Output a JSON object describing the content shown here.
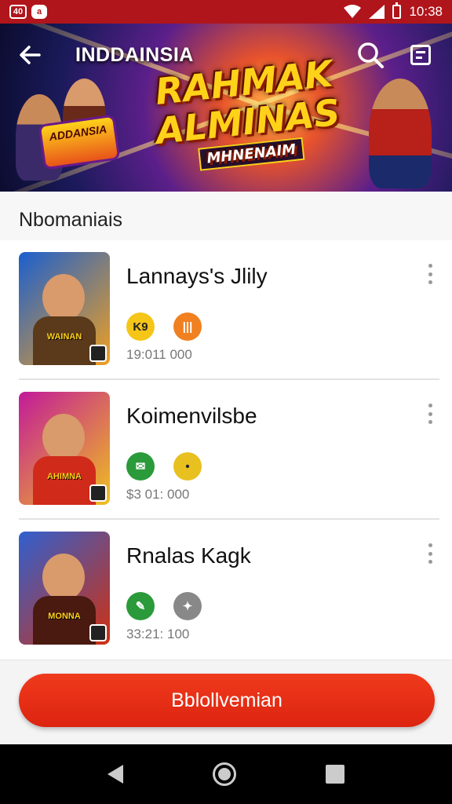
{
  "status_bar": {
    "time": "10:38",
    "left_icons": [
      "calendar-icon",
      "app-notification-icon"
    ],
    "left_icon_labels": [
      "40",
      "a"
    ]
  },
  "header": {
    "title": "INDDAINSIA",
    "hero_line1": "RAHMAK",
    "hero_line2": "ALMINAS",
    "hero_line3": "MHNENAIM",
    "hero_badge": "ADDANSIA"
  },
  "section": {
    "title": "Nbomaniais"
  },
  "items": [
    {
      "name": "Lannays's Jlily",
      "meta": "19:011 000",
      "thumb_label": "WAINAN",
      "thumb_colors": [
        "#1a5fd0",
        "#f0a020"
      ],
      "badges": [
        {
          "icon": "k9-badge-icon",
          "text": "K9",
          "bg": "#f5c518",
          "fg": "#222"
        },
        {
          "icon": "piano-badge-icon",
          "text": "|||",
          "bg": "#f08020",
          "fg": "#fff"
        }
      ]
    },
    {
      "name": "Koimenvilsbe",
      "meta": "$3 01: 000",
      "thumb_label": "AHIMNA",
      "thumb_colors": [
        "#c21a9a",
        "#f0c020"
      ],
      "badges": [
        {
          "icon": "chat-badge-icon",
          "text": "✉",
          "bg": "#2a9a3a",
          "fg": "#fff"
        },
        {
          "icon": "speech-badge-icon",
          "text": "•",
          "bg": "#e8c020",
          "fg": "#222"
        }
      ]
    },
    {
      "name": "Rnalas Kagk",
      "meta": "33:21: 100",
      "thumb_label": "MONNA",
      "thumb_colors": [
        "#d03010",
        "#3060d0"
      ],
      "badges": [
        {
          "icon": "leaf-badge-icon",
          "text": "✎",
          "bg": "#2a9a3a",
          "fg": "#fff"
        },
        {
          "icon": "tool-badge-icon",
          "text": "✦",
          "bg": "#888888",
          "fg": "#fff"
        }
      ]
    }
  ],
  "cta": {
    "label": "Bblollvemian"
  },
  "colors": {
    "accent": "#dc2410",
    "status_bar": "#b0151b"
  }
}
